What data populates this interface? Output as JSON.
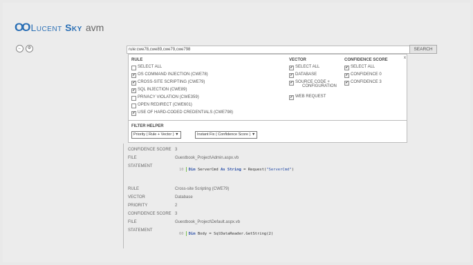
{
  "brand": {
    "mark": "OO",
    "name_a": "Lucent ",
    "name_b": "Sky",
    "name_c": "avm"
  },
  "nav": {
    "back": "←",
    "settings": "⚙"
  },
  "search": {
    "query": "rule:cwe78,cwe89,cwe79,cwe798",
    "button": "SEARCH"
  },
  "filter": {
    "close": "x",
    "rule": {
      "title": "RULE",
      "items": [
        {
          "label": "SELECT ALL",
          "checked": false
        },
        {
          "label": "OS COMMAND INJECTION (CWE78)",
          "checked": true
        },
        {
          "label": "CROSS-SITE SCRIPTING (CWE79)",
          "checked": true
        },
        {
          "label": "SQL INJECTION (CWE89)",
          "checked": true
        },
        {
          "label": "PRIVACY VIOLATION (CWE359)",
          "checked": false
        },
        {
          "label": "OPEN REDIRECT (CWE601)",
          "checked": false
        },
        {
          "label": "USE OF HARD-CODED CREDENTIALS (CWE798)",
          "checked": true
        }
      ]
    },
    "vector": {
      "title": "VECTOR",
      "items": [
        {
          "label": "SELECT ALL",
          "checked": true
        },
        {
          "label": "DATABASE",
          "checked": true
        },
        {
          "label": "SOURCE CODE +",
          "label2": "CONFIGURATION",
          "checked": true
        },
        {
          "label": "WEB REQUEST",
          "checked": true
        }
      ]
    },
    "confidence": {
      "title": "CONFIDENCE SCORE",
      "items": [
        {
          "label": "SELECT ALL",
          "checked": true
        },
        {
          "label": "CONFIDENCE 0",
          "checked": true
        },
        {
          "label": "CONFIDENCE 3",
          "checked": true
        }
      ]
    },
    "helper": {
      "title": "FILTER HELPER",
      "select1": "Priority ( Rule + Vector )",
      "select2": "Instant Fix ( Confidence Score )",
      "arrow": "▼"
    }
  },
  "results": [
    {
      "confidence_label": "CONFIDENCE SCORE",
      "confidence": "3",
      "file_label": "FILE",
      "file": "Guestbook_Project\\Admin.aspx.vb",
      "statement_label": "STATEMENT",
      "code": {
        "line": "10",
        "kw1": "Dim",
        "var": " ServerCmd ",
        "kw2": "As String",
        "rest": " = Request(",
        "str": "\"ServerCmd\"",
        "end": ")"
      }
    },
    {
      "rule_label": "RULE",
      "rule": "Cross-site Scripting (CWE79)",
      "vector_label": "VECTOR",
      "vector": "Database",
      "priority_label": "PRIORITY",
      "priority": "2",
      "confidence_label": "CONFIDENCE SCORE",
      "confidence": "3",
      "file_label": "FILE",
      "file": "Guestbook_Project\\Default.aspx.vb",
      "statement_label": "STATEMENT",
      "code": {
        "line": "60",
        "kw1": "Dim",
        "var": " Body = SqlDataReader.GetString(2)"
      }
    }
  ]
}
